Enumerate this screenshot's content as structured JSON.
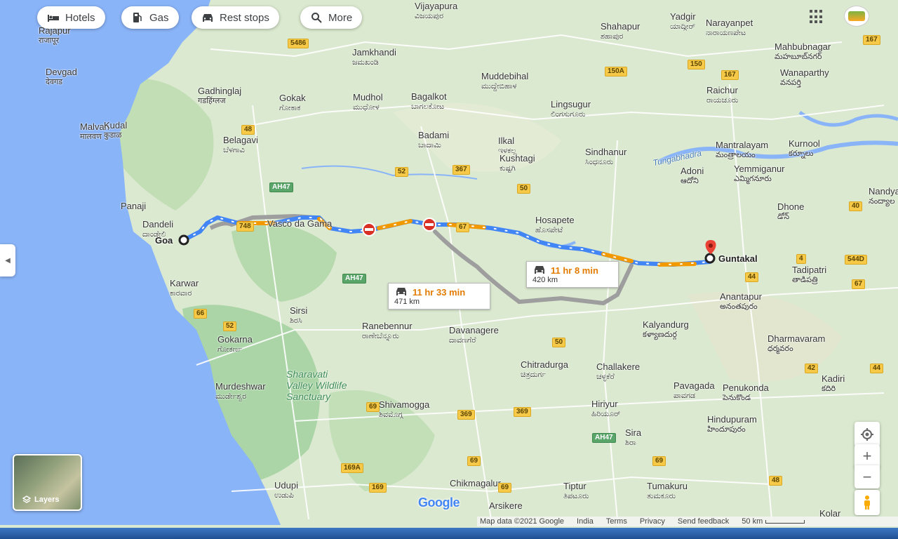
{
  "toolbar": {
    "chips": [
      {
        "label": "Hotels",
        "icon": "bed-icon"
      },
      {
        "label": "Gas",
        "icon": "gas-pump-icon"
      },
      {
        "label": "Rest stops",
        "icon": "car-icon"
      },
      {
        "label": "More",
        "icon": "search-icon"
      }
    ]
  },
  "route": {
    "origin": "Goa",
    "destination": "Guntakal",
    "primary": {
      "time": "11 hr 8 min",
      "distance": "420 km"
    },
    "alternate": {
      "time": "11 hr 33 min",
      "distance": "471 km"
    }
  },
  "places": [
    {
      "name": "Vijayapura",
      "native": "ವಿಜಯಪುರ"
    },
    {
      "name": "Yadgir",
      "native": "ಯಾದ್ಗೀರ್"
    },
    {
      "name": "Narayanpet",
      "native": "ನಾರಾಯಣಪೇಟ"
    },
    {
      "name": "Rajapur",
      "native": "राजापूर"
    },
    {
      "name": "Shahapur",
      "native": "ಶಹಾಪುರ"
    },
    {
      "name": "Mahbubnagar",
      "native": "మహబూబ్‌నగర్"
    },
    {
      "name": "Jamkhandi",
      "native": "ಜಮಖಂಡಿ"
    },
    {
      "name": "Devgad",
      "native": "देवगड"
    },
    {
      "name": "Muddebihal",
      "native": "ಮುದ್ದೇಬಿಹಾಳ"
    },
    {
      "name": "Wanaparthy",
      "native": "వనపర్తి"
    },
    {
      "name": "Gadhinglaj",
      "native": "गडहिंग्लज"
    },
    {
      "name": "Gokak",
      "native": "ಗೋಕಾಕ"
    },
    {
      "name": "Mudhol",
      "native": "ಮುಧೋಳ"
    },
    {
      "name": "Bagalkot",
      "native": "ಬಾಗಲಕೋಟ"
    },
    {
      "name": "Lingsugur",
      "native": "ಲಿಂಗಸುಗೂರು"
    },
    {
      "name": "Raichur",
      "native": "ರಾಯಚೂರು"
    },
    {
      "name": "Malvan",
      "native": "मालवण"
    },
    {
      "name": "Kudal",
      "native": "कुडाळ"
    },
    {
      "name": "Belagavi",
      "native": "ಬೆಳಗಾವಿ"
    },
    {
      "name": "Badami",
      "native": "ಬಾದಾಮಿ"
    },
    {
      "name": "Ilkal",
      "native": "ಇಳಕಲ್ಲ"
    },
    {
      "name": "Kushtagi",
      "native": "ಕುಷ್ಟಗಿ"
    },
    {
      "name": "Sindhanur",
      "native": "ಸಿಂಧನೂರು"
    },
    {
      "name": "Mantralayam",
      "native": "మంత్రాలయం"
    },
    {
      "name": "Kurnool",
      "native": "కర్నూలు"
    },
    {
      "name": "Adoni",
      "native": "ఆదోని"
    },
    {
      "name": "Yemmiganur",
      "native": "ఎమ్మిగనూరు"
    },
    {
      "name": "Panaji",
      "native": ""
    },
    {
      "name": "Vasco da Gama",
      "native": ""
    },
    {
      "name": "Dandeli",
      "native": "ದಾಂಡೇಲಿ"
    },
    {
      "name": "Hosapete",
      "native": "ಹೊಸಪೇಟೆ"
    },
    {
      "name": "Dhone",
      "native": "డోన్"
    },
    {
      "name": "Nandyal",
      "native": "నంద్యాల"
    },
    {
      "name": "Tadipatri",
      "native": "తాడిపత్రి"
    },
    {
      "name": "Karwar",
      "native": "ಕಾರವಾರ"
    },
    {
      "name": "Anantapur",
      "native": "అనంతపురం"
    },
    {
      "name": "Sirsi",
      "native": "ಶಿರಸಿ"
    },
    {
      "name": "Ranebennur",
      "native": "ರಾಣೇಬೆನ್ನೂರು"
    },
    {
      "name": "Davanagere",
      "native": "ದಾವಣಗೆರೆ"
    },
    {
      "name": "Kalyandurg",
      "native": "కళ్యాణదుర్గ"
    },
    {
      "name": "Gokarna",
      "native": "ಗೋಕರ್ಣ"
    },
    {
      "name": "Dharmavaram",
      "native": "ధర్మవరం"
    },
    {
      "name": "Chitradurga",
      "native": "ಚಿತ್ರದುರ್ಗ"
    },
    {
      "name": "Challakere",
      "native": "ಚಳ್ಳಕೆರೆ"
    },
    {
      "name": "Kadiri",
      "native": "కదిరి"
    },
    {
      "name": "Murdeshwar",
      "native": "ಮುರ್ಡೇಶ್ವರ"
    },
    {
      "name": "Pavagada",
      "native": "ಪಾವಗಡ"
    },
    {
      "name": "Penukonda",
      "native": "పెనుకొండ"
    },
    {
      "name": "Shivamogga",
      "native": "ಶಿವಮೊಗ್ಗ"
    },
    {
      "name": "Hiriyur",
      "native": "ಹಿರಿಯೂರ್"
    },
    {
      "name": "Hindupuram",
      "native": "హిందూపురం"
    },
    {
      "name": "Sira",
      "native": "ಶಿರಾ"
    },
    {
      "name": "Udupi",
      "native": "ಉಡುಪಿ"
    },
    {
      "name": "Chikmagalur",
      "native": ""
    },
    {
      "name": "Tiptur",
      "native": "ತಿಪಟೂರು"
    },
    {
      "name": "Tumakuru",
      "native": "ತುಮಕೂರು"
    },
    {
      "name": "Arsikere",
      "native": ""
    },
    {
      "name": "Kolar",
      "native": ""
    }
  ],
  "features": {
    "sanctuary": "Sharavati Valley Wildlife Sanctuary",
    "river": "Tungabhadra"
  },
  "highways": [
    "5486",
    "150A",
    "150",
    "167",
    "167",
    "48",
    "52",
    "367",
    "50",
    "AH47",
    "748",
    "67",
    "4",
    "544D",
    "44",
    "40",
    "67",
    "52",
    "AH47",
    "50",
    "42",
    "44",
    "69",
    "369",
    "369",
    "AH47",
    "69",
    "69",
    "169A",
    "169",
    "69",
    "48",
    "66"
  ],
  "layers": {
    "label": "Layers"
  },
  "google_logo": "Google",
  "footer": {
    "map_data": "Map data ©2021 Google",
    "country": "India",
    "terms": "Terms",
    "privacy": "Privacy",
    "feedback": "Send feedback",
    "scale": "50 km"
  },
  "controls": {
    "zoom_in": "+",
    "zoom_out": "−"
  },
  "colors": {
    "route_primary": "#4285f4",
    "route_alt": "#9e9e9e",
    "traffic": "#f29900",
    "sea": "#8ab4f8",
    "land": "#d7ead0"
  }
}
